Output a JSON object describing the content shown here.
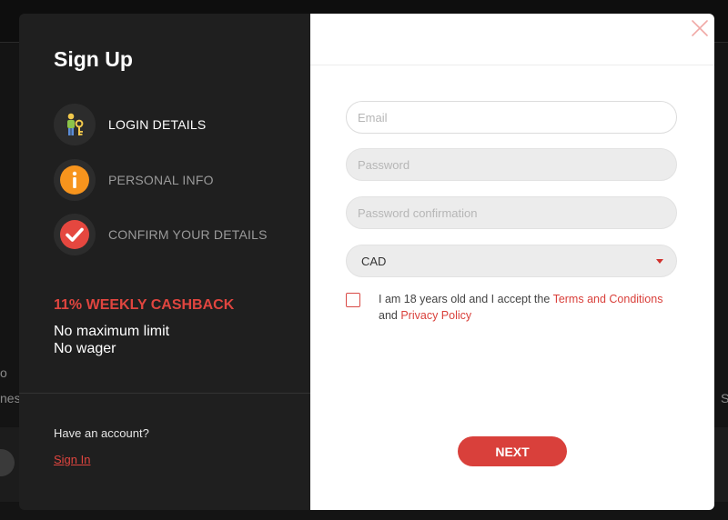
{
  "background": {
    "fragments": [
      "o",
      "nes",
      "S"
    ]
  },
  "signup": {
    "title": "Sign Up",
    "steps": [
      {
        "label": "LOGIN DETAILS",
        "icon": "key-person-icon",
        "state": "active"
      },
      {
        "label": "PERSONAL INFO",
        "icon": "info-icon",
        "state": "inactive"
      },
      {
        "label": "CONFIRM YOUR DETAILS",
        "icon": "checkmark-icon",
        "state": "inactive"
      }
    ],
    "promo": {
      "title": "11% WEEKLY CASHBACK",
      "line1": "No maximum limit",
      "line2": "No wager"
    },
    "have_account": "Have an account?",
    "signin_label": "Sign In"
  },
  "form": {
    "email": {
      "placeholder": "Email",
      "value": ""
    },
    "password": {
      "placeholder": "Password",
      "value": ""
    },
    "password_confirmation": {
      "placeholder": "Password confirmation",
      "value": ""
    },
    "currency": {
      "selected": "CAD"
    },
    "terms": {
      "prefix": "I am 18 years old and I accept the ",
      "terms_link": "Terms and Conditions",
      "middle": " and ",
      "privacy_link": "Privacy Policy"
    },
    "next_label": "NEXT"
  },
  "colors": {
    "accent": "#d9403b",
    "left_panel": "#1f1f1f",
    "right_panel": "#ffffff"
  }
}
